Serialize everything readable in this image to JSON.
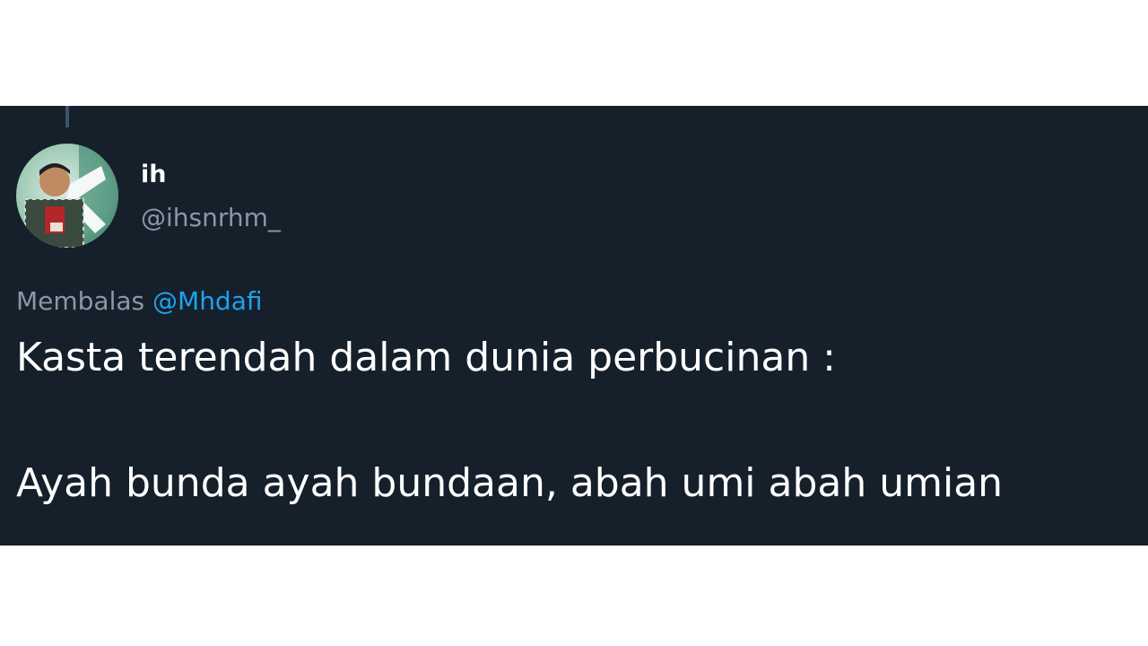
{
  "colors": {
    "page_background": "#ffffff",
    "card_background": "#15202b",
    "primary_text": "#ffffff",
    "secondary_text": "#8899a6",
    "link": "#1da1f2"
  },
  "tweet": {
    "author": {
      "display_name": "ih",
      "handle": "@ihsnrhm_",
      "avatar_icon": "avatar-photo"
    },
    "reply_to": {
      "prefix": "Membalas",
      "mention": "@Mhdafi"
    },
    "text_lines": [
      "Kasta terendah dalam dunia perbucinan :",
      "Ayah bunda ayah bundaan, abah umi abah umian"
    ]
  }
}
